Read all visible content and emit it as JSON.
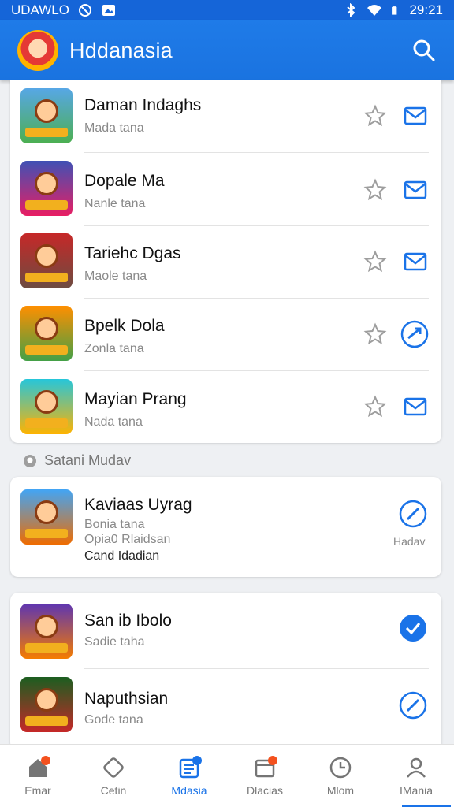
{
  "status_bar": {
    "carrier": "UDAWLO",
    "time": "29:21"
  },
  "app_bar": {
    "title": "Hddanasia"
  },
  "list": [
    {
      "title": "Daman Indaghs",
      "subtitle": "Mada tana",
      "action": "mail-icon"
    },
    {
      "title": "Dopale Ma",
      "subtitle": "Nanle tana",
      "action": "mail-icon"
    },
    {
      "title": "Tariehc Dgas",
      "subtitle": "Maole tana",
      "action": "mail-icon"
    },
    {
      "title": "Bpelk Dola",
      "subtitle": "Zonla tana",
      "action": "share-icon"
    },
    {
      "title": "Mayian Prang",
      "subtitle": "Nada tana",
      "action": "mail-icon"
    }
  ],
  "section": {
    "label": "Satani Mudav"
  },
  "featured": {
    "title": "Kaviaas Uyrag",
    "lines": [
      "Bonia tana",
      "Opia0 Rlaidsan",
      "Cand Idadian"
    ],
    "action_label": "Hadav"
  },
  "list2": [
    {
      "title": "San ib Ibolo",
      "subtitle": "Sadie taha",
      "checked": true
    },
    {
      "title": "Naputhsian",
      "subtitle": "Gode tana",
      "checked": false
    }
  ],
  "bottom_nav": [
    {
      "label": "Emar",
      "icon": "home-icon",
      "badge": true
    },
    {
      "label": "Cetin",
      "icon": "tag-icon",
      "badge": false
    },
    {
      "label": "Mdasia",
      "icon": "document-icon",
      "badge": true,
      "active": true
    },
    {
      "label": "Dlacias",
      "icon": "calendar-icon",
      "badge": true
    },
    {
      "label": "Mlom",
      "icon": "clock-icon",
      "badge": false
    },
    {
      "label": "IMania",
      "icon": "profile-icon",
      "badge": false
    }
  ],
  "colors": {
    "primary": "#1a73e8",
    "star": "#9e9e9e",
    "badge": "#f4511e"
  }
}
